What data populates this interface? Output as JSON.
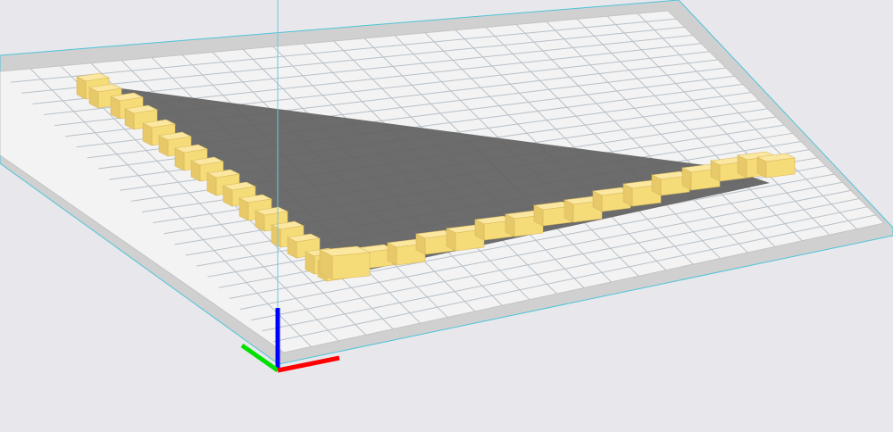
{
  "viewport": {
    "background_color": "#e8e8ec",
    "bed_color": "#f2f2f2",
    "bed_border_color": "#c9c9c9",
    "grid_color": "#a9b8c4",
    "bed_edge_color": "#4fc3d9",
    "shadow_color": "#666666",
    "model_color": "#f6dc79",
    "model_shadow_color": "#d9b95a",
    "vertical_line_color": "#6ec6e6"
  },
  "axes": {
    "x_icon": "x-axis-arrow",
    "y_icon": "y-axis-arrow",
    "z_icon": "z-axis-arrow",
    "x_color": "#ff0000",
    "y_color": "#00e000",
    "z_color": "#0000ff"
  }
}
